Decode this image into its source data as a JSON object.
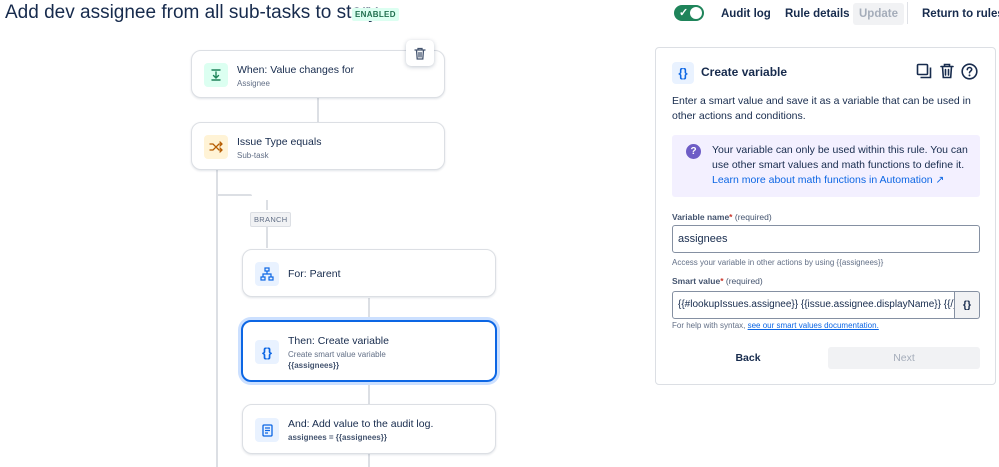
{
  "header": {
    "title": "Add dev assignee from all sub-tasks to story",
    "status_badge": "ENABLED",
    "toggle_check": "✓",
    "buttons": {
      "audit_log": "Audit log",
      "rule_details": "Rule details",
      "update": "Update",
      "return_to_rules": "Return to rules"
    }
  },
  "flow": {
    "trigger": {
      "title": "When: Value changes for",
      "subtitle": "Assignee",
      "icon": "value-change-icon"
    },
    "condition": {
      "title": "Issue Type equals",
      "subtitle": "Sub-task",
      "icon": "shuffle-icon"
    },
    "branch_label": "BRANCH",
    "branch_step": {
      "title": "For: Parent",
      "icon": "hierarchy-icon"
    },
    "action_create": {
      "title": "Then: Create variable",
      "subtitle": "Create smart value variable",
      "detail": "{{assignees}}",
      "icon_glyph": "{}"
    },
    "action_log": {
      "title": "And: Add value to the audit log.",
      "detail": "assignees = {{assignees}}",
      "icon": "document-icon"
    }
  },
  "panel": {
    "icon_glyph": "{}",
    "title": "Create variable",
    "description": "Enter a smart value and save it as a variable that can be used in other actions and conditions.",
    "info": {
      "icon_glyph": "?",
      "text": "Your variable can only be used within this rule. You can use other smart values and math functions to define it.",
      "link": "Learn more about math functions in Automation ↗"
    },
    "variable_name": {
      "label": "Variable name",
      "required_mark": "*",
      "required_text": "(required)",
      "value": "assignees",
      "helper": "Access your variable in other actions by using {{assignees}}"
    },
    "smart_value": {
      "label": "Smart value",
      "required_mark": "*",
      "required_text": "(required)",
      "value": "{{#lookupIssues.assignee}} {{issue.assignee.displayName}} {{/}}",
      "button_glyph": "{}",
      "helper": "For help with syntax,",
      "helper_link": "see our smart values documentation."
    },
    "back": "Back",
    "next": "Next"
  },
  "colors": {
    "accent": "#0c66e4",
    "success": "#1f845a",
    "info_bg": "#f3f0ff"
  }
}
